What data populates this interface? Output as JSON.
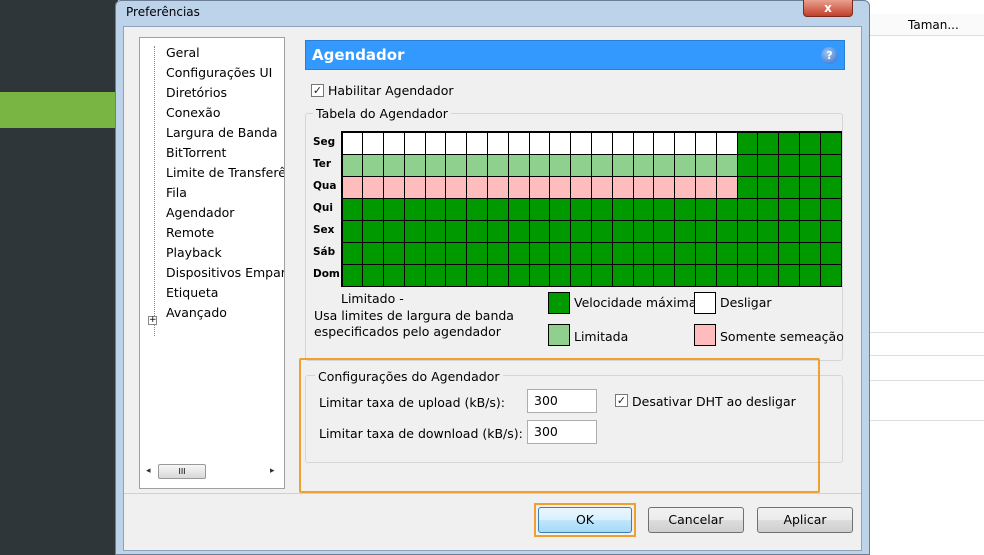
{
  "background": {
    "column_header": "Taman..."
  },
  "dialog": {
    "title": "Preferências",
    "close_label": "x",
    "tree": {
      "items": [
        "Geral",
        "Configurações UI",
        "Diretórios",
        "Conexão",
        "Largura de Banda",
        "BitTorrent",
        "Limite de Transferência",
        "Fila",
        "Agendador",
        "Remote",
        "Playback",
        "Dispositivos Emparelhados",
        "Etiqueta",
        "Avançado"
      ],
      "expander": "+",
      "scroll_thumb": "III",
      "scroll_left": "◂",
      "scroll_right": "▸"
    },
    "panel": {
      "title": "Agendador",
      "help": "?",
      "enable_label": "Habilitar Agendador",
      "enable_checked": "✓",
      "table_group": "Tabela do Agendador",
      "days": [
        "Seg",
        "Ter",
        "Qua",
        "Qui",
        "Sex",
        "Sáb",
        "Dom"
      ],
      "schedule_codes": "O=Desligar, L=Limitada, S=Somente semeação, F=Velocidade máxima",
      "schedule": [
        "OOOOOOOOOOOOOOOOOOOFFFFF",
        "LLLLLLLLLLLLLLLLLLLFFFFF",
        "SSSSSSSSSSSSSSSSSSSFFFFF",
        "FFFFFFFFFFFFFFFFFFFFFFFF",
        "FFFFFFFFFFFFFFFFFFFFFFFF",
        "FFFFFFFFFFFFFFFFFFFFFFFF",
        "FFFFFFFFFFFFFFFFFFFFFFFF"
      ],
      "colors": {
        "F": "#009900",
        "L": "#8fd08f",
        "S": "#ffbcbc",
        "O": "#ffffff"
      },
      "info_title": "Limitado -",
      "info_line1": "Usa limites de largura de banda",
      "info_line2": "especificados pelo agendador",
      "legend": {
        "full": "Velocidade máxima",
        "off": "Desligar",
        "limited": "Limitada",
        "seed": "Somente semeação"
      },
      "config_group": "Configurações do Agendador",
      "upload_label": "Limitar taxa de upload (kB/s):",
      "upload_value": "300",
      "download_label": "Limitar taxa de download (kB/s):",
      "download_value": "300",
      "dht_label": "Desativar DHT ao desligar",
      "dht_checked": "✓"
    },
    "buttons": {
      "ok": "OK",
      "cancel": "Cancelar",
      "apply": "Aplicar"
    }
  }
}
